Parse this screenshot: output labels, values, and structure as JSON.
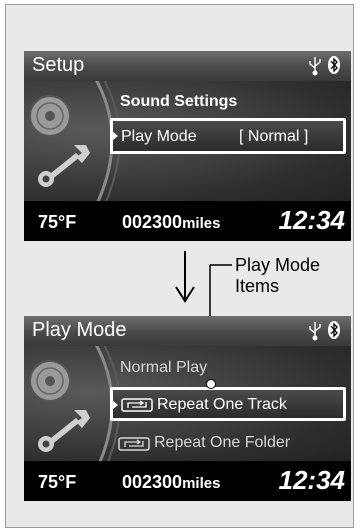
{
  "screen_top": {
    "title": "Setup",
    "heading": "Sound Settings",
    "selected_item": "Play Mode",
    "selected_value": "[ Normal ]"
  },
  "screen_bottom": {
    "title": "Play Mode",
    "items": [
      {
        "label": "Normal Play"
      },
      {
        "label": "Repeat One Track",
        "icon": "repeat-track-icon"
      },
      {
        "label": "Repeat One Folder",
        "icon": "repeat-folder-icon"
      }
    ]
  },
  "footer": {
    "temperature": "75°F",
    "odometer_value": "002300",
    "odometer_unit": "miles",
    "time": "12:34"
  },
  "callout": {
    "line1": "Play Mode",
    "line2": "Items"
  },
  "icons": [
    "usb-icon",
    "bluetooth-icon",
    "cd-icon",
    "wrench-icon",
    "down-arrow-icon"
  ]
}
